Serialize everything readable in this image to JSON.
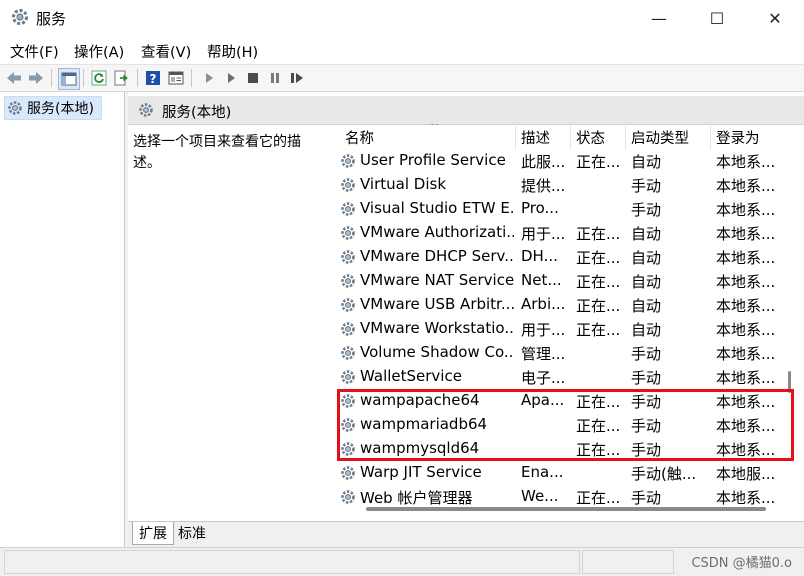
{
  "window": {
    "title": "服务",
    "minimize_glyph": "—",
    "maximize_glyph": "☐",
    "close_glyph": "✕"
  },
  "menu": [
    {
      "label": "文件(F)"
    },
    {
      "label": "操作(A)"
    },
    {
      "label": "查看(V)"
    },
    {
      "label": "帮助(H)"
    }
  ],
  "toolbar": {
    "icons": [
      "back-icon",
      "forward-icon",
      "console-tree-icon",
      "refresh-icon",
      "export-list-icon",
      "help-icon",
      "properties-icon",
      "start-service-icon",
      "start-service-alt-icon",
      "stop-service-icon",
      "pause-service-icon",
      "restart-service-icon"
    ]
  },
  "tree": {
    "selected_label": "服务(本地)"
  },
  "pane": {
    "title": "服务(本地)",
    "description": "选择一个项目来查看它的描述。"
  },
  "columns": [
    "名称",
    "描述",
    "状态",
    "启动类型",
    "登录为"
  ],
  "services": [
    {
      "name": "User Profile Service",
      "desc": "此服...",
      "status": "正在...",
      "startup": "自动",
      "logon": "本地系..."
    },
    {
      "name": "Virtual Disk",
      "desc": "提供...",
      "status": "",
      "startup": "手动",
      "logon": "本地系..."
    },
    {
      "name": "Visual Studio ETW E...",
      "desc": "Pro...",
      "status": "",
      "startup": "手动",
      "logon": "本地系..."
    },
    {
      "name": "VMware Authorizati...",
      "desc": "用于...",
      "status": "正在...",
      "startup": "自动",
      "logon": "本地系..."
    },
    {
      "name": "VMware DHCP Serv...",
      "desc": "DH...",
      "status": "正在...",
      "startup": "自动",
      "logon": "本地系..."
    },
    {
      "name": "VMware NAT Service",
      "desc": "Net...",
      "status": "正在...",
      "startup": "自动",
      "logon": "本地系..."
    },
    {
      "name": "VMware USB Arbitr...",
      "desc": "Arbi...",
      "status": "正在...",
      "startup": "自动",
      "logon": "本地系..."
    },
    {
      "name": "VMware Workstatio...",
      "desc": "用于...",
      "status": "正在...",
      "startup": "自动",
      "logon": "本地系..."
    },
    {
      "name": "Volume Shadow Co...",
      "desc": "管理...",
      "status": "",
      "startup": "手动",
      "logon": "本地系..."
    },
    {
      "name": "WalletService",
      "desc": "电子...",
      "status": "",
      "startup": "手动",
      "logon": "本地系..."
    },
    {
      "name": "wampapache64",
      "desc": "Apa...",
      "status": "正在...",
      "startup": "手动",
      "logon": "本地系..."
    },
    {
      "name": "wampmariadb64",
      "desc": "",
      "status": "正在...",
      "startup": "手动",
      "logon": "本地系..."
    },
    {
      "name": "wampmysqld64",
      "desc": "",
      "status": "正在...",
      "startup": "手动",
      "logon": "本地系..."
    },
    {
      "name": "Warp JIT Service",
      "desc": "Ena...",
      "status": "",
      "startup": "手动(触...",
      "logon": "本地服..."
    },
    {
      "name": "Web 帐户管理器",
      "desc": "We...",
      "status": "正在...",
      "startup": "手动",
      "logon": "本地系..."
    }
  ],
  "tabs": [
    "扩展",
    "标准"
  ],
  "status": {
    "watermark": "CSDN @橘猫0.o"
  },
  "colors": {
    "highlight_box": "#e3101a",
    "selected_tree": "#d9e8fb"
  }
}
